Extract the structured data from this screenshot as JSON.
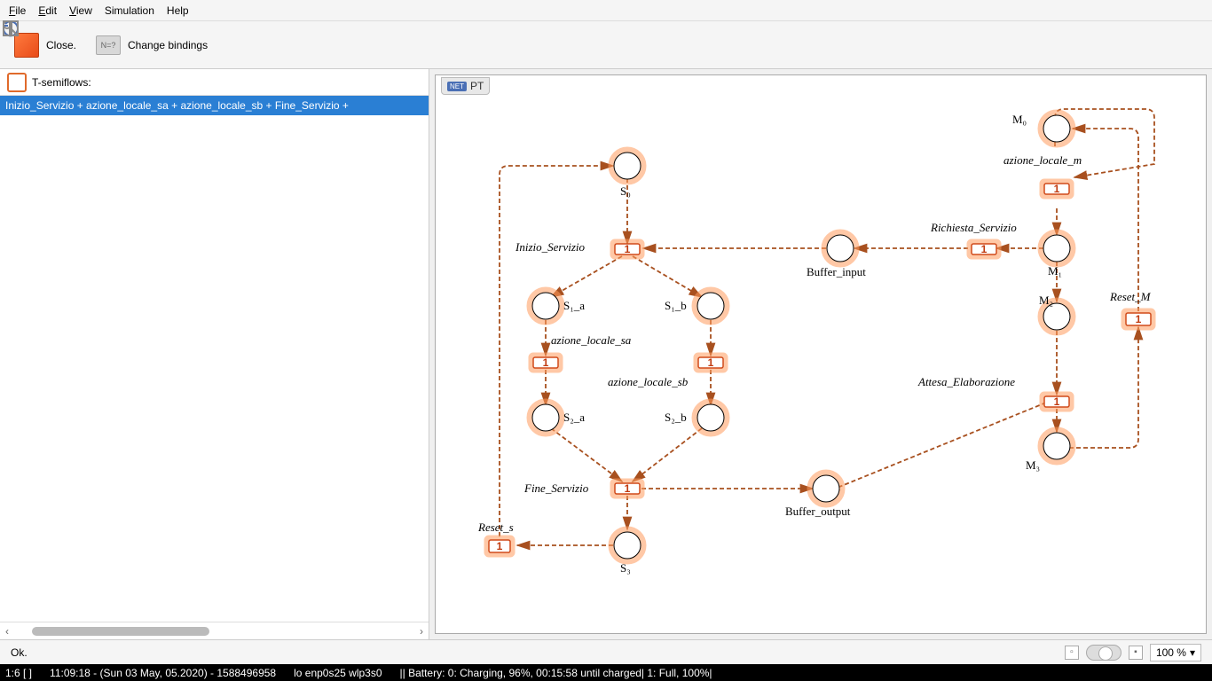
{
  "menu": {
    "file": "File",
    "edit": "Edit",
    "view": "View",
    "sim": "Simulation",
    "help": "Help"
  },
  "toolbar": {
    "close": "Close.",
    "change": "Change bindings"
  },
  "left": {
    "header": "T-semiflows:",
    "row": "Inizio_Servizio + azione_locale_sa + azione_locale_sb + Fine_Servizio +"
  },
  "canvas": {
    "title": "PT",
    "badge": "NET"
  },
  "places": {
    "s0": "S₀",
    "s1a": "S₁_a",
    "s1b": "S₁_b",
    "s2a": "S₂_a",
    "s2b": "S₂_b",
    "s3": "S₃",
    "bi": "Buffer_input",
    "bo": "Buffer_output",
    "m0": "M₀",
    "m1": "M₁",
    "m2": "M₂",
    "m3": "M₃"
  },
  "trans": {
    "inizio": "Inizio_Servizio",
    "asa": "azione_locale_sa",
    "asb": "azione_locale_sb",
    "fine": "Fine_Servizio",
    "resets": "Reset_s",
    "richiesta": "Richiesta_Servizio",
    "alm": "azione_locale_m",
    "attesa": "Attesa_Elaborazione",
    "resetm": "Reset_M"
  },
  "tval": "1",
  "status": {
    "msg": "Ok.",
    "zoom": "100 %"
  },
  "sysbar": {
    "a": "1:6 [ ]",
    "b": "11:09:18 - (Sun 03 May, 05.2020) - 1588496958",
    "c": "lo enp0s25 wlp3s0",
    "d": "||   Battery: 0: Charging, 96%, 00:15:58 until charged| 1: Full, 100%|"
  }
}
